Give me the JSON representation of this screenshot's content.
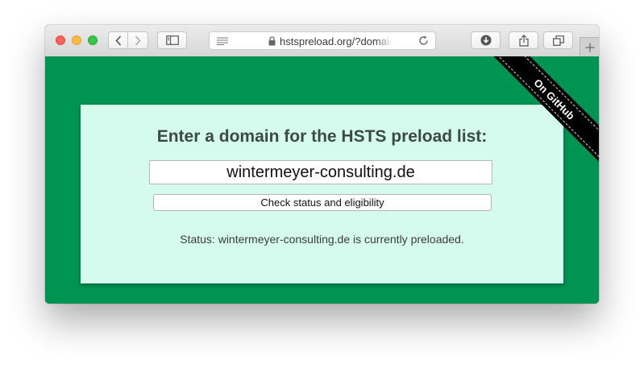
{
  "browser": {
    "url": "hstspreload.org/?domain=",
    "icons": {
      "back": "chevron-left-icon",
      "forward": "chevron-right-icon",
      "sidebar": "sidebar-icon",
      "reader": "reader-icon",
      "lock": "lock-icon",
      "reload": "reload-icon",
      "downloads": "download-icon",
      "share": "share-icon",
      "tabs": "tabs-icon",
      "new_tab": "plus-icon"
    }
  },
  "page": {
    "background": "#009452",
    "panel_color": "#d4fbed",
    "heading": "Enter a domain for the HSTS preload list:",
    "domain_value": "wintermeyer-consulting.de",
    "check_button": "Check status and eligibility",
    "status_text": "Status: wintermeyer-consulting.de is currently preloaded.",
    "ribbon_text": "On GitHub"
  }
}
